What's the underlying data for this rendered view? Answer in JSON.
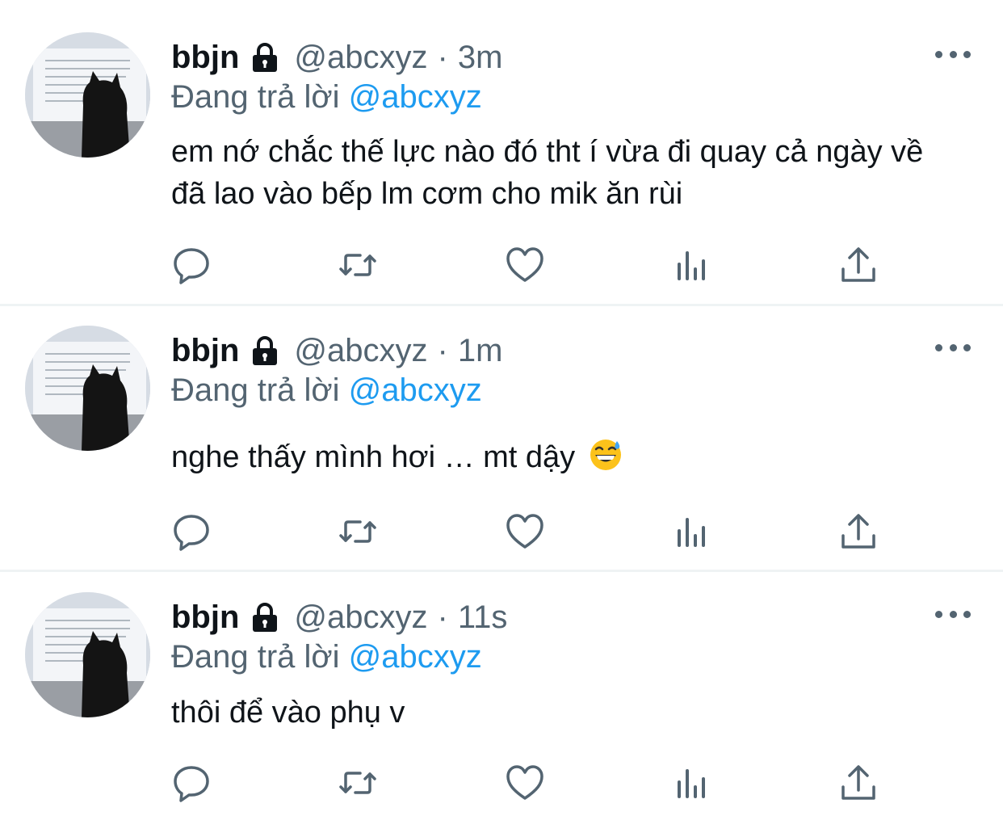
{
  "tweets": [
    {
      "name": "bbjn",
      "handle": "@abcxyz",
      "dot": "·",
      "time": "3m",
      "reply_prefix": "Đang trả lời",
      "reply_to": "@abcxyz",
      "text": "em nớ chắc thế lực nào đó tht í vừa đi quay cả ngày về đã lao vào bếp lm cơm cho mik ăn rùi"
    },
    {
      "name": "bbjn",
      "handle": "@abcxyz",
      "dot": "·",
      "time": "1m",
      "reply_prefix": "Đang trả lời",
      "reply_to": "@abcxyz",
      "text": "nghe thấy mình hơi … mt dậy",
      "emoji": "grinning-face-with-sweat"
    },
    {
      "name": "bbjn",
      "handle": "@abcxyz",
      "dot": "·",
      "time": "11s",
      "reply_prefix": "Đang trả lời",
      "reply_to": "@abcxyz",
      "text": "thôi để vào phụ v"
    }
  ],
  "icons": {
    "lock": "lock-icon",
    "more": "more-icon",
    "reply": "reply-icon",
    "retweet": "retweet-icon",
    "like": "like-icon",
    "views": "views-icon",
    "share": "share-icon"
  },
  "colors": {
    "text": "#0f1419",
    "secondary": "#536471",
    "accent": "#1d9bf0",
    "divider": "#eff3f4"
  }
}
